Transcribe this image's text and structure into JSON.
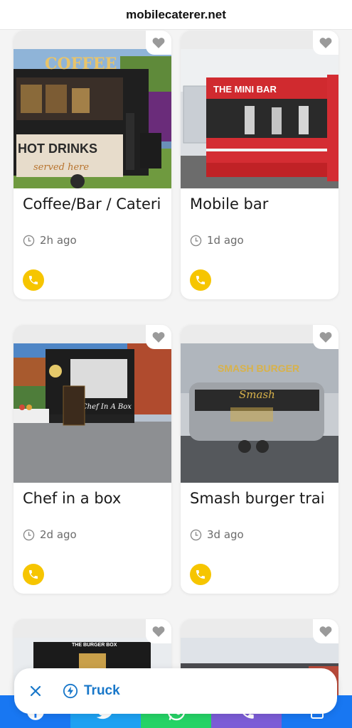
{
  "browser": {
    "url": "mobilecaterer.net"
  },
  "listings": [
    {
      "title": "Coffee/Bar / Cateri",
      "time": "2h ago"
    },
    {
      "title": "Mobile bar",
      "time": "1d ago"
    },
    {
      "title": "Chef in a box",
      "time": "2d ago"
    },
    {
      "title": "Smash burger trai",
      "time": "3d ago"
    },
    {
      "title": "",
      "time": ""
    },
    {
      "title": "",
      "time": ""
    }
  ],
  "photo_text": {
    "coffee_sign": "COFFEE",
    "hot_drinks": "HOT DRINKS",
    "served_here": "served here",
    "mini_bar": "THE MINI BAR",
    "chef_sign": "Chef In A Box",
    "smash_sign": "SMASH BURGER",
    "smash_script": "Smash",
    "burger_box": "THE BURGER BOX"
  },
  "filter": {
    "chip_label": "Truck"
  },
  "share_colors": [
    "#1877f2",
    "#1da1f2",
    "#25d366",
    "#7b5cd6",
    "#1877f2"
  ],
  "icons": [
    "heart-icon",
    "clock-icon",
    "phone-icon",
    "close-icon",
    "lightning-icon",
    "facebook-icon",
    "twitter-icon",
    "whatsapp-icon",
    "phone-icon",
    "share-icon"
  ]
}
